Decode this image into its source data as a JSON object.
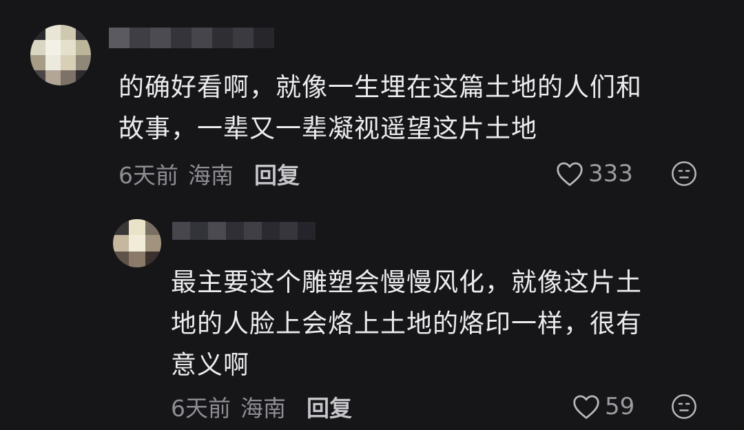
{
  "comments": [
    {
      "text": "的确好看啊，就像一生埋在这篇土地的人们和\n故事，一辈又一辈凝视遥望这片土地",
      "time": "6天前",
      "location": "海南",
      "reply_label": "回复",
      "likes": "333"
    },
    {
      "text": "最主要这个雕塑会慢慢风化，就像这片土\n地的人脸上会烙上土地的烙印一样，很有\n意义啊",
      "time": "6天前",
      "location": "海南",
      "reply_label": "回复",
      "likes": "59"
    }
  ],
  "icons": {
    "like": "heart-outline-icon",
    "dislike": "meh-face-icon"
  },
  "colors": {
    "background": "#161619",
    "text": "#ececee",
    "meta": "#8d8d93",
    "reply": "#c6c6ca"
  }
}
